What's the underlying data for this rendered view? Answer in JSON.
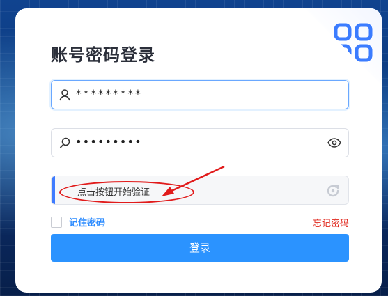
{
  "title": "账号密码登录",
  "username": {
    "value": "*********"
  },
  "password": {
    "value": "•••••••••"
  },
  "captcha": {
    "label": "点击按钮开始验证"
  },
  "remember": {
    "label": "记住密码"
  },
  "forgot": {
    "label": "忘记密码"
  },
  "login": {
    "label": "登录"
  },
  "colors": {
    "accent": "#2B93FF",
    "danger": "#E0261B",
    "title": "#2B2F3A"
  },
  "icons": [
    "qrcode-icon",
    "user-icon",
    "search-icon",
    "eye-icon",
    "refresh-icon"
  ]
}
